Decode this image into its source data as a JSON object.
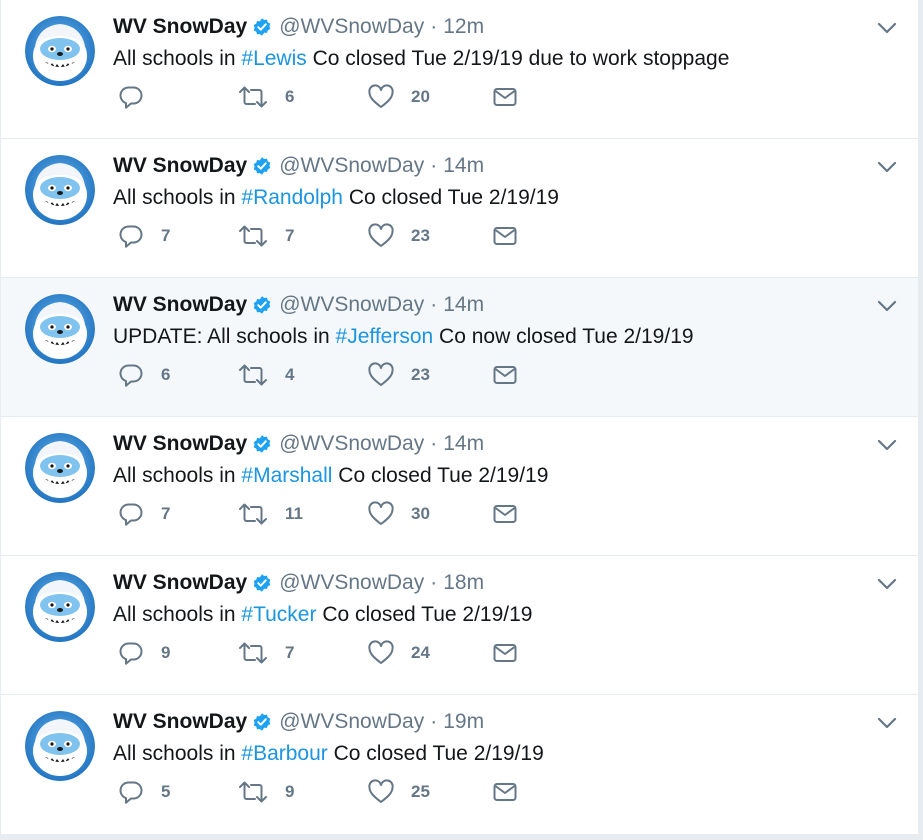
{
  "colors": {
    "hashtag": "#1b95e0",
    "muted": "#657786",
    "verified": "#1da1f2",
    "highlight_bg": "#f5f8fa"
  },
  "icons": {
    "reply": "reply-icon",
    "retweet": "retweet-icon",
    "like": "heart-icon",
    "dm": "envelope-icon",
    "menu": "chevron-down-icon",
    "verified": "verified-badge-icon"
  },
  "tweets": [
    {
      "name": "WV SnowDay",
      "handle": "@WVSnowDay",
      "sep": "·",
      "time": "12m",
      "text_before": "All schools in ",
      "hashtag": "#Lewis",
      "text_after": " Co closed Tue 2/19/19 due to work stoppage",
      "replies": "",
      "retweets": "6",
      "likes": "20",
      "highlighted": false
    },
    {
      "name": "WV SnowDay",
      "handle": "@WVSnowDay",
      "sep": "·",
      "time": "14m",
      "text_before": "All schools in ",
      "hashtag": "#Randolph",
      "text_after": " Co closed Tue 2/19/19",
      "replies": "7",
      "retweets": "7",
      "likes": "23",
      "highlighted": false
    },
    {
      "name": "WV SnowDay",
      "handle": "@WVSnowDay",
      "sep": "·",
      "time": "14m",
      "text_before": "UPDATE: All schools in ",
      "hashtag": "#Jefferson",
      "text_after": " Co now closed Tue 2/19/19",
      "replies": "6",
      "retweets": "4",
      "likes": "23",
      "highlighted": true
    },
    {
      "name": "WV SnowDay",
      "handle": "@WVSnowDay",
      "sep": "·",
      "time": "14m",
      "text_before": "All schools in ",
      "hashtag": "#Marshall",
      "text_after": " Co closed Tue 2/19/19",
      "replies": "7",
      "retweets": "11",
      "likes": "30",
      "highlighted": false
    },
    {
      "name": "WV SnowDay",
      "handle": "@WVSnowDay",
      "sep": "·",
      "time": "18m",
      "text_before": "All schools in ",
      "hashtag": "#Tucker",
      "text_after": " Co closed Tue 2/19/19",
      "replies": "9",
      "retweets": "7",
      "likes": "24",
      "highlighted": false
    },
    {
      "name": "WV SnowDay",
      "handle": "@WVSnowDay",
      "sep": "·",
      "time": "19m",
      "text_before": "All schools in ",
      "hashtag": "#Barbour",
      "text_after": " Co closed Tue 2/19/19",
      "replies": "5",
      "retweets": "9",
      "likes": "25",
      "highlighted": false
    }
  ]
}
